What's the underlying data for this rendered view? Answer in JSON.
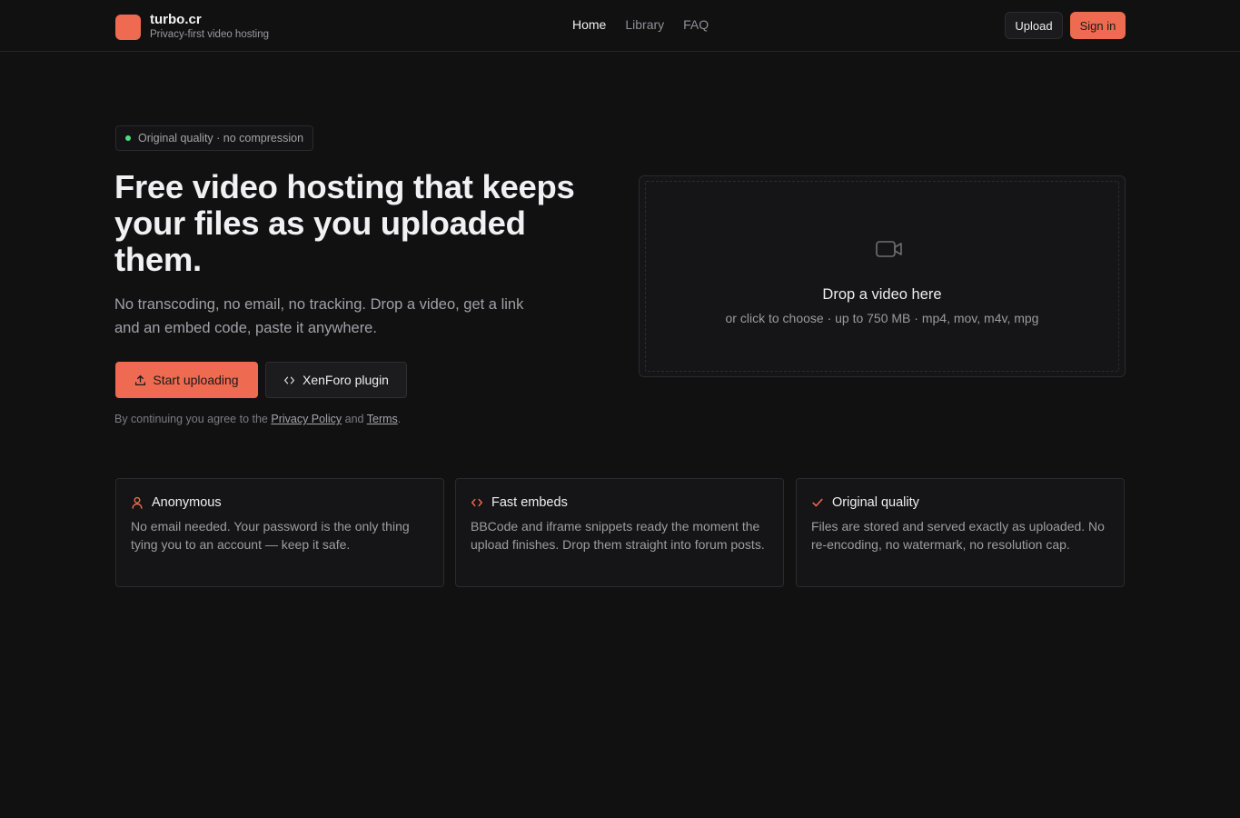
{
  "header": {
    "brand_name": "turbo.cr",
    "brand_tagline": "Privacy-first video hosting",
    "nav": [
      {
        "label": "Home",
        "active": true
      },
      {
        "label": "Library",
        "active": false
      },
      {
        "label": "FAQ",
        "active": false
      }
    ],
    "upload_label": "Upload",
    "signin_label": "Sign in"
  },
  "hero": {
    "badge": "Original quality · no compression",
    "title": "Free video hosting that keeps your files as you uploaded them.",
    "subtitle": "No transcoding, no email, no tracking. Drop a video, get a link and an embed code, paste it anywhere.",
    "start_label": "Start uploading",
    "plugin_label": "XenForo plugin",
    "legal_prefix": "By continuing you agree to the",
    "privacy_link": "Privacy Policy",
    "legal_and": "and",
    "terms_link": "Terms",
    "legal_suffix": "."
  },
  "dropzone": {
    "icon": "video-camera-icon",
    "title": "Drop a video here",
    "hint": "or click to choose · up to 750 MB · mp4, mov, m4v, mpg"
  },
  "features": [
    {
      "icon": "user-icon",
      "title": "Anonymous",
      "desc": "No email needed. Your password is the only thing tying you to an account — keep it safe."
    },
    {
      "icon": "code-icon",
      "title": "Fast embeds",
      "desc": "BBCode and iframe snippets ready the moment the upload finishes. Drop them straight into forum posts."
    },
    {
      "icon": "check-icon",
      "title": "Original quality",
      "desc": "Files are stored and served exactly as uploaded. No re-encoding, no watermark, no resolution cap."
    }
  ],
  "colors": {
    "accent": "#ee6a50",
    "background": "#111112",
    "status_dot": "#4ade80"
  }
}
